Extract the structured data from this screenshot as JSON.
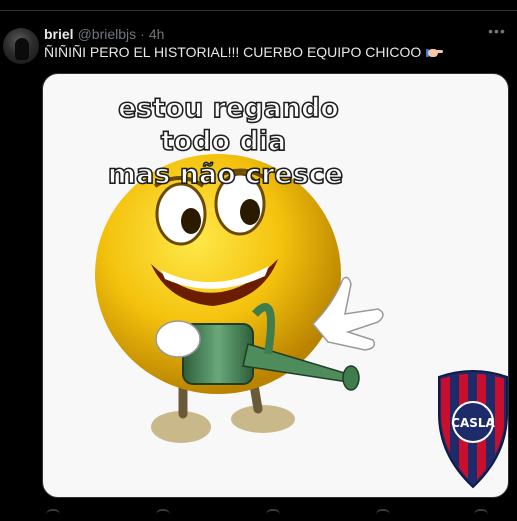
{
  "tweet": {
    "display_name": "briel",
    "handle": "@brielbjs",
    "separator": "·",
    "time": "4h",
    "more_icon": "more-horizontal-icon",
    "text": "ÑIÑIÑI PERO EL HISTORIAL!!! CUERBO EQUIPO CHICOO",
    "emoji": "pointing-hand-emoji"
  },
  "media": {
    "caption_lines": [
      "estou regando",
      "todo dia",
      "mas não cresce"
    ],
    "crest_text": "CASLA",
    "colors": {
      "smiley": "#f4c20d",
      "crest_red": "#c8102e",
      "crest_blue": "#1d2b6b",
      "can": "#3f7d4e"
    }
  },
  "colors": {
    "background": "#000000",
    "text_primary": "#e7e9ea",
    "text_secondary": "#71767b",
    "border": "#2f3336"
  }
}
